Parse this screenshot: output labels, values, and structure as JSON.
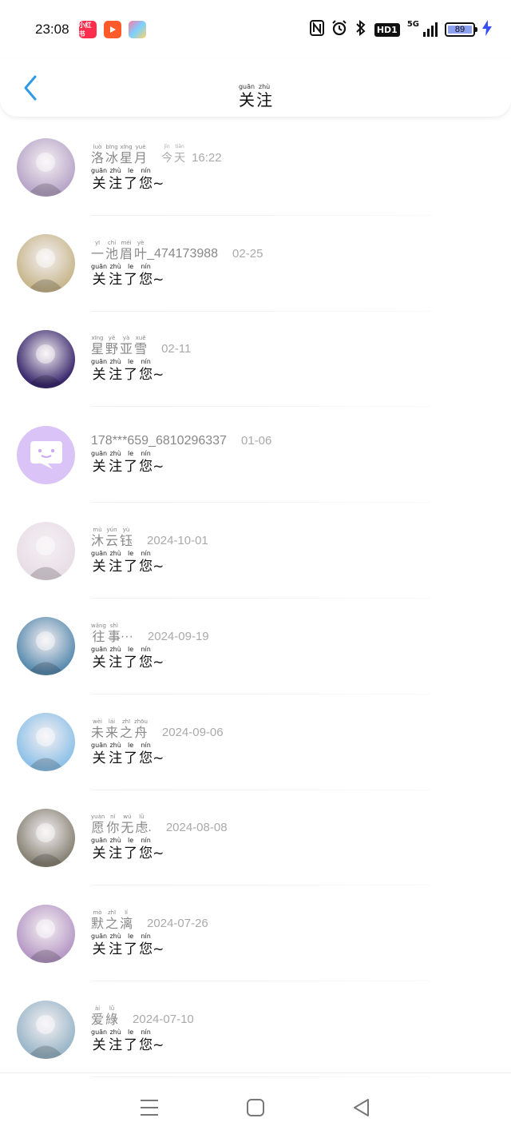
{
  "status_bar": {
    "time": "23:08",
    "apps": [
      "小红书",
      "video-app",
      "multi-app"
    ],
    "battery": "89",
    "network": "5G",
    "hd": "HD1"
  },
  "header": {
    "title_pinyin": [
      "guān",
      "zhù"
    ],
    "title_chars": [
      "关",
      "注"
    ]
  },
  "message": {
    "pinyin": [
      "guān",
      "zhù",
      "le",
      "nín"
    ],
    "chars": [
      "关",
      "注",
      "了",
      "您"
    ],
    "tail": "~"
  },
  "today": {
    "pinyin": [
      "jīn",
      "tiān"
    ],
    "chars": [
      "今",
      "天"
    ]
  },
  "items": [
    {
      "name_chars": [
        "洛",
        "冰",
        "星",
        "月"
      ],
      "name_pinyin": [
        "luò",
        "bīng",
        "xīng",
        "yuè"
      ],
      "name_tail": "",
      "date": "16:22",
      "today": true,
      "avatar_color": "#b9a7c9"
    },
    {
      "name_chars": [
        "一",
        "池",
        "眉",
        "叶"
      ],
      "name_pinyin": [
        "yī",
        "chí",
        "méi",
        "yè"
      ],
      "name_tail": "_474173988",
      "date": "02-25",
      "avatar_color": "#c8b88e"
    },
    {
      "name_chars": [
        "星",
        "野",
        "亚",
        "雪"
      ],
      "name_pinyin": [
        "xīng",
        "yě",
        "yà",
        "xuě"
      ],
      "name_tail": "",
      "date": "02-11",
      "avatar_color": "#3b2a6e"
    },
    {
      "plain_name": "178***659_6810296337",
      "date": "01-06",
      "avatar_color": "#d9c3f7",
      "default_avatar": true
    },
    {
      "name_chars": [
        "沐",
        "云",
        "钰"
      ],
      "name_pinyin": [
        "mù",
        "yún",
        "yù"
      ],
      "name_tail": "",
      "date": "2024-10-01",
      "avatar_color": "#e8dfe6"
    },
    {
      "name_chars": [
        "往",
        "事"
      ],
      "name_pinyin": [
        "wǎng",
        "shì"
      ],
      "name_tail": "···",
      "date": "2024-09-19",
      "avatar_color": "#5c8db0"
    },
    {
      "name_chars": [
        "未",
        "来",
        "之",
        "舟"
      ],
      "name_pinyin": [
        "wèi",
        "lái",
        "zhī",
        "zhōu"
      ],
      "name_tail": "",
      "date": "2024-09-06",
      "avatar_color": "#8fc2e8"
    },
    {
      "name_chars": [
        "愿",
        "你",
        "无",
        "虑"
      ],
      "name_pinyin": [
        "yuàn",
        "nǐ",
        "wú",
        "lǜ"
      ],
      "name_tail": ".",
      "date": "2024-08-08",
      "avatar_color": "#8a8577"
    },
    {
      "name_chars": [
        "默",
        "之",
        "漓"
      ],
      "name_pinyin": [
        "mò",
        "zhī",
        "lí"
      ],
      "name_tail": "",
      "date": "2024-07-26",
      "avatar_color": "#b79ac6"
    },
    {
      "name_chars": [
        "爱",
        "綠"
      ],
      "name_pinyin": [
        "ài",
        "lǜ"
      ],
      "name_tail": "",
      "date": "2024-07-10",
      "avatar_color": "#9bb7c9"
    }
  ],
  "colors": {
    "accent": "#2f9be8",
    "bolt": "#3550ff"
  },
  "icons": {
    "back": "chevron-left-icon",
    "menu": "menu-icon",
    "home": "home-icon",
    "recent": "back-triangle-icon"
  }
}
